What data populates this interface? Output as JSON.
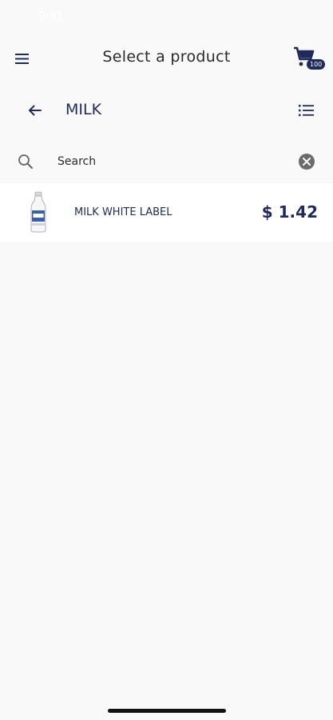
{
  "status_bar": {
    "time": "9:41"
  },
  "header": {
    "title": "Select a product",
    "cart_badge": "100",
    "menu_icon": "hamburger-menu-icon",
    "cart_icon": "shopping-cart-icon"
  },
  "category": {
    "title": "MILK",
    "back_icon": "arrow-left-icon",
    "view_icon": "list-view-icon"
  },
  "search": {
    "placeholder": "Search",
    "value": "",
    "search_icon": "search-icon",
    "clear_icon": "clear-circle-icon"
  },
  "products": [
    {
      "name": "MILK WHITE LABEL",
      "price": "$ 1.42",
      "image_icon": "milk-bottle-icon"
    }
  ],
  "colors": {
    "primary": "#1f2a5c",
    "background": "#f9f9f9",
    "card": "#ffffff"
  }
}
